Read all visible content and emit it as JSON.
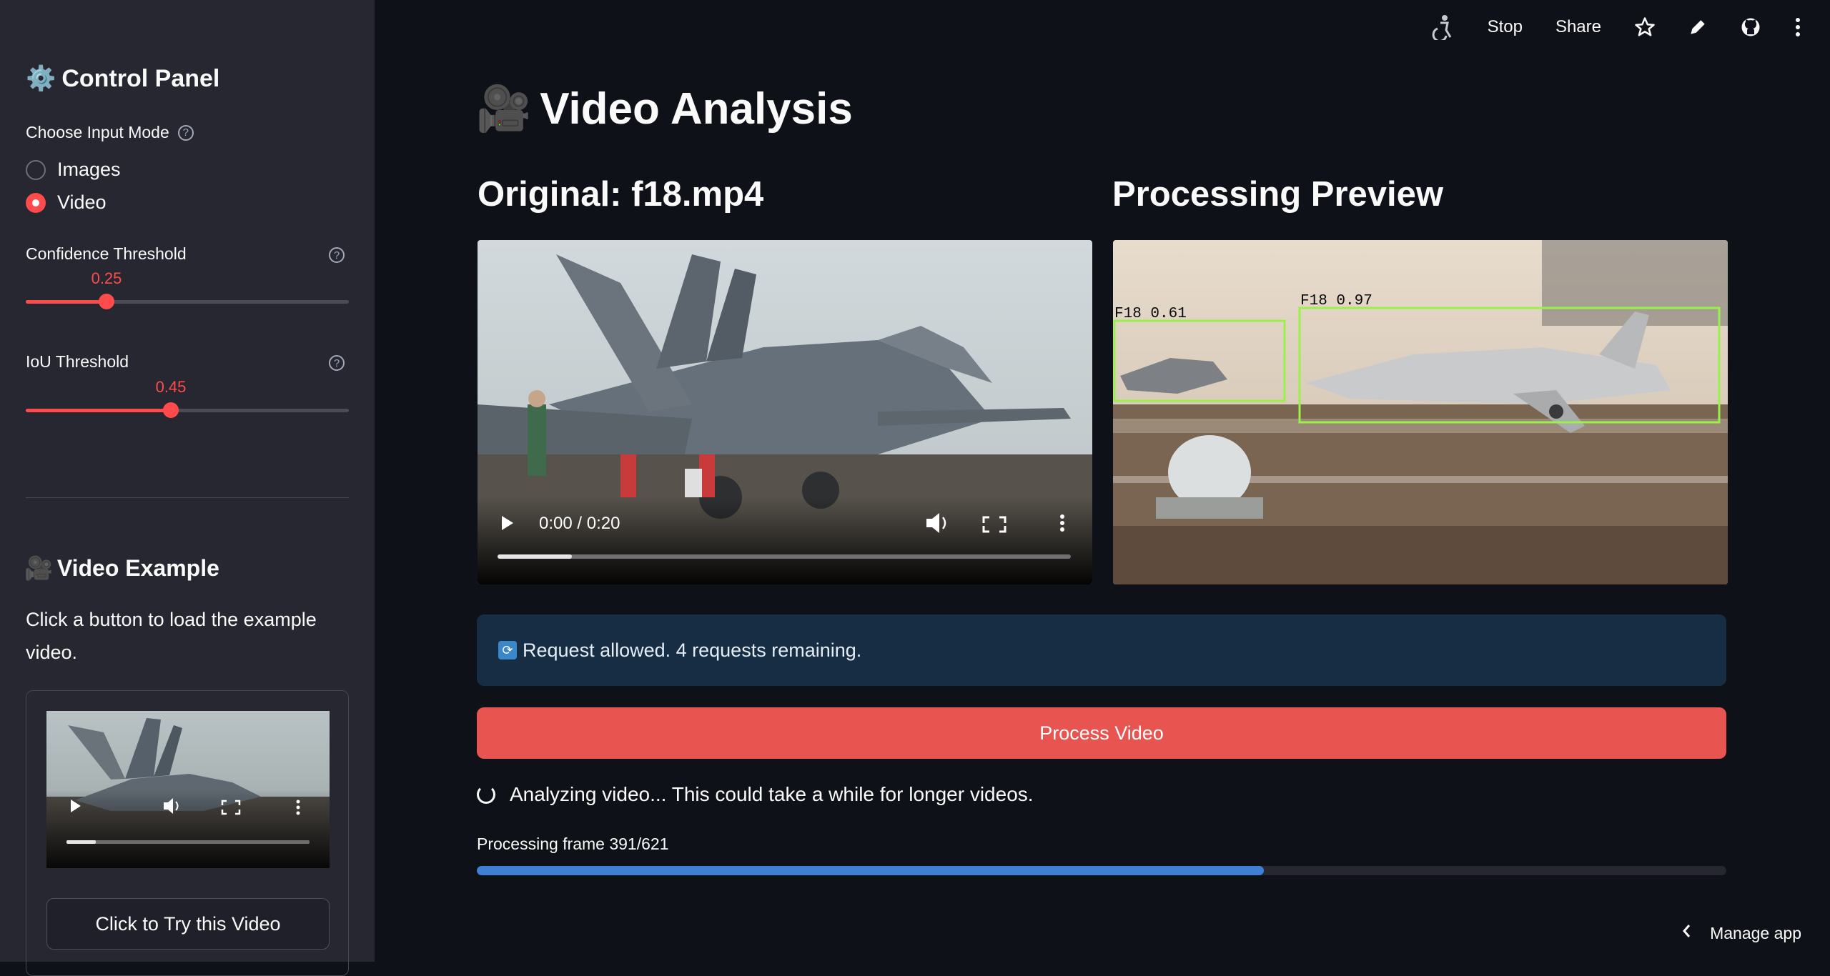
{
  "sidebar": {
    "title_icon": "⚙️",
    "title": "Control Panel",
    "input_mode": {
      "label": "Choose Input Mode",
      "options": [
        {
          "label": "Images",
          "selected": false
        },
        {
          "label": "Video",
          "selected": true
        }
      ]
    },
    "confidence": {
      "label": "Confidence Threshold",
      "value": "0.25",
      "fraction": 0.25
    },
    "iou": {
      "label": "IoU Threshold",
      "value": "0.45",
      "fraction": 0.45
    },
    "example": {
      "icon": "🎥",
      "title": "Video Example",
      "text": "Click a button to load the example video.",
      "button_label": "Click to Try this Video",
      "progress_fraction": 0.12
    }
  },
  "toolbar": {
    "stop_label": "Stop",
    "share_label": "Share",
    "icons": [
      "accessibility-icon",
      "star-icon",
      "pencil-icon",
      "github-icon",
      "more-vertical-icon"
    ]
  },
  "main": {
    "title_icon": "🎥",
    "title": "Video Analysis",
    "original": {
      "title": "Original: f18.mp4",
      "time": "0:00 / 0:20",
      "progress_fraction": 0.13
    },
    "preview": {
      "title": "Processing Preview",
      "detections": [
        {
          "label": "F18 0.61"
        },
        {
          "label": "F18 0.97"
        }
      ]
    },
    "info": "Request allowed. 4 requests remaining.",
    "process_button": "Process Video",
    "status": "Analyzing video... This could take a while for longer videos.",
    "progress_label": "Processing frame 391/621",
    "progress_fraction": 0.6296
  },
  "footer": {
    "manage_label": "Manage app"
  },
  "colors": {
    "accent": "#ff4b4b",
    "background": "#0e1117",
    "sidebar": "#262730",
    "progress": "#3f7fd6",
    "detection_box": "#9bf04a"
  }
}
